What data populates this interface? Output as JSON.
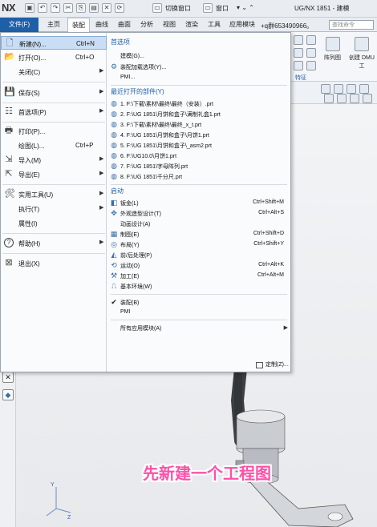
{
  "titlebar": {
    "logo": "NX",
    "switch_window_label": "切换窗口",
    "window_label": "窗口",
    "app_title": "UG/NX 1851 - 建模"
  },
  "tabs": {
    "file": "文件(F)",
    "items": [
      "主页",
      "装配",
      "曲线",
      "曲面",
      "分析",
      "视图",
      "渲染",
      "工具",
      "应用模块"
    ],
    "qq_text": "+q群653490966。",
    "search_placeholder": "查找命令"
  },
  "ribbon": {
    "pattern_label": "阵列图",
    "dmu_label": "创建 DMU 工",
    "feature_label": "特征"
  },
  "menu": {
    "left": [
      {
        "label": "新建(N)...",
        "shortcut": "Ctrl+N",
        "icon": "new-file-icon",
        "glyph": "🗋"
      },
      {
        "label": "打开(O)...",
        "shortcut": "Ctrl+O",
        "icon": "open-folder-icon",
        "glyph": "📂"
      },
      {
        "label": "关闭(C)",
        "shortcut": "",
        "icon": "",
        "glyph": ""
      },
      {
        "label": "保存(S)",
        "shortcut": "",
        "icon": "save-icon",
        "glyph": "💾"
      },
      {
        "label": "首选项(P)",
        "shortcut": "",
        "icon": "preferences-icon",
        "glyph": "☷"
      },
      {
        "label": "打印(P)...",
        "shortcut": "",
        "icon": "print-icon",
        "glyph": "🖶"
      },
      {
        "label": "绘图(L)...",
        "shortcut": "Ctrl+P",
        "icon": "",
        "glyph": ""
      },
      {
        "label": "导入(M)",
        "shortcut": "",
        "icon": "import-icon",
        "glyph": "⇲"
      },
      {
        "label": "导出(E)",
        "shortcut": "",
        "icon": "export-icon",
        "glyph": "⇱"
      },
      {
        "label": "实用工具(U)",
        "shortcut": "",
        "icon": "tools-icon",
        "glyph": "🛠"
      },
      {
        "label": "执行(T)",
        "shortcut": "",
        "icon": "",
        "glyph": ""
      },
      {
        "label": "属性(I)",
        "shortcut": "",
        "icon": "",
        "glyph": ""
      },
      {
        "label": "帮助(H)",
        "shortcut": "",
        "icon": "help-icon",
        "glyph": "?"
      },
      {
        "label": "退出(X)",
        "shortcut": "",
        "icon": "exit-icon",
        "glyph": "⊠"
      }
    ],
    "right": {
      "pref_header": "首选项",
      "pref_items": [
        "建模(G)...",
        "装配加载选项(Y)...",
        "PMI..."
      ],
      "recent_header": "最近打开的部件(Y)",
      "recent": [
        "1. F:\\下载\\素材\\最终\\最终（安装）.prt",
        "2. F:\\UG 1851\\月饼和盒子\\满制礼盒1.prt",
        "3. F:\\下载\\素材\\最终\\最终_x_t.prt",
        "4. F:\\UG 1851\\月饼和盒子\\月饼1.prt",
        "5. F:\\UG 1851\\月饼和盒子\\_asm2.prt",
        "6. F:\\UG10.0\\月饼1.prt",
        "7. F:\\UG 1851\\字母阵列.prt",
        "8. F:\\UG 1851\\千分尺.prt"
      ],
      "launch_header": "启动",
      "launch": [
        {
          "label": "钣金(L)",
          "shortcut": "Ctrl+Shift+M"
        },
        {
          "label": "外观造型设计(T)",
          "shortcut": "Ctrl+Alt+S"
        },
        {
          "label": "动画设计(A)",
          "shortcut": ""
        },
        {
          "label": "制图(E)",
          "shortcut": "Ctrl+Shift+D"
        },
        {
          "label": "布局(Y)",
          "shortcut": "Ctrl+Shift+Y"
        },
        {
          "label": "前/后处理(P)",
          "shortcut": ""
        },
        {
          "label": "运动(O)",
          "shortcut": "Ctrl+Alt+K"
        },
        {
          "label": "加工(E)",
          "shortcut": "Ctrl+Alt+M"
        },
        {
          "label": "基本环境(W)",
          "shortcut": ""
        }
      ],
      "apps": [
        "装配(B)",
        "PMI"
      ],
      "all_apps": "所有应用模块(A)",
      "customize": "定制(Z)..."
    }
  },
  "caption": "先新建一个工程图"
}
